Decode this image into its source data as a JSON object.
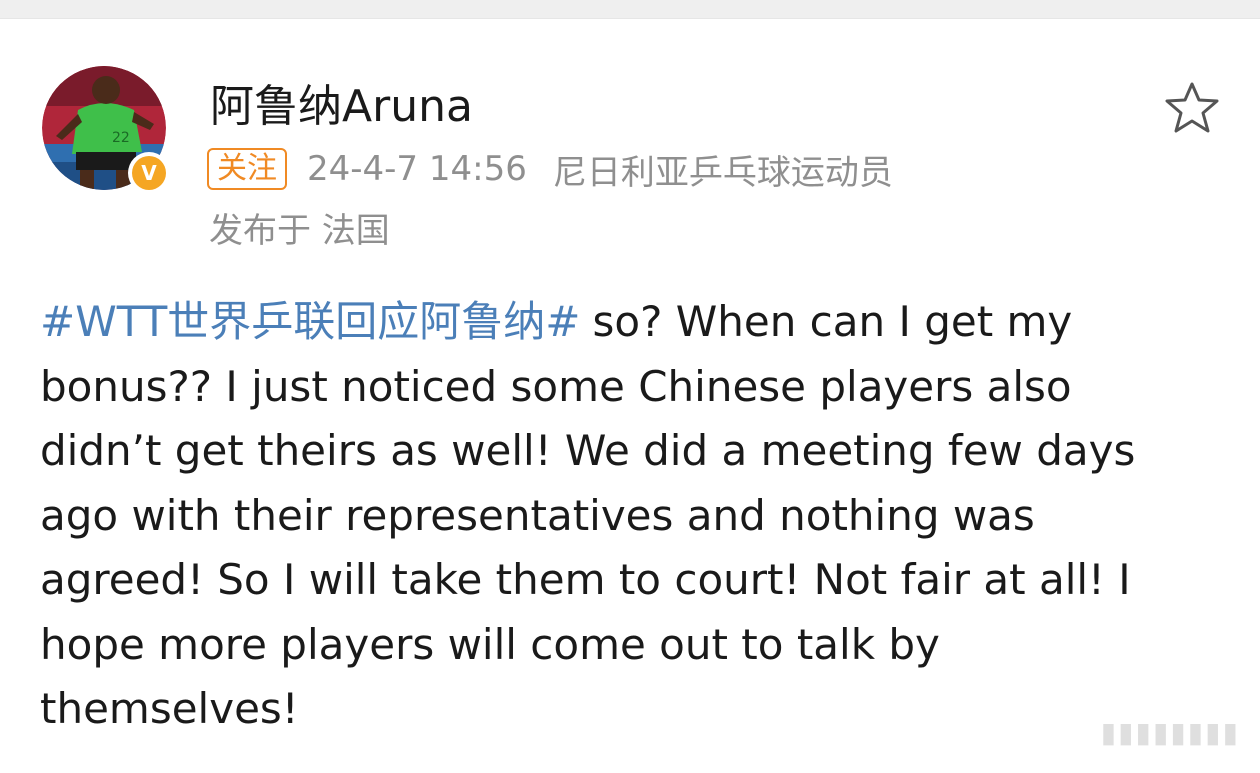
{
  "post": {
    "username": "阿鲁纳Aruna",
    "follow_label": "关注",
    "timestamp": "24-4-7 14:56",
    "source": "尼日利亚乒乓球运动员",
    "location": "发布于 法国",
    "hashtag": "#WTT世界乒联回应阿鲁纳#",
    "text": "so? When can I get my bonus?? I just noticed some Chinese players also didn’t get theirs as well! We did a meeting few days ago with their representatives and nothing was agreed! So I will take them to court! Not fair at all! I hope more players will come out to talk by themselves!"
  },
  "icons": {
    "verified": "verified-v-icon",
    "favorite": "star-outline-icon"
  },
  "colors": {
    "hashtag": "#4b7fb8",
    "follow": "#f08a24",
    "verified": "#f5a623",
    "meta_text": "#8f8f8f",
    "body_text": "#1a1a1a"
  }
}
